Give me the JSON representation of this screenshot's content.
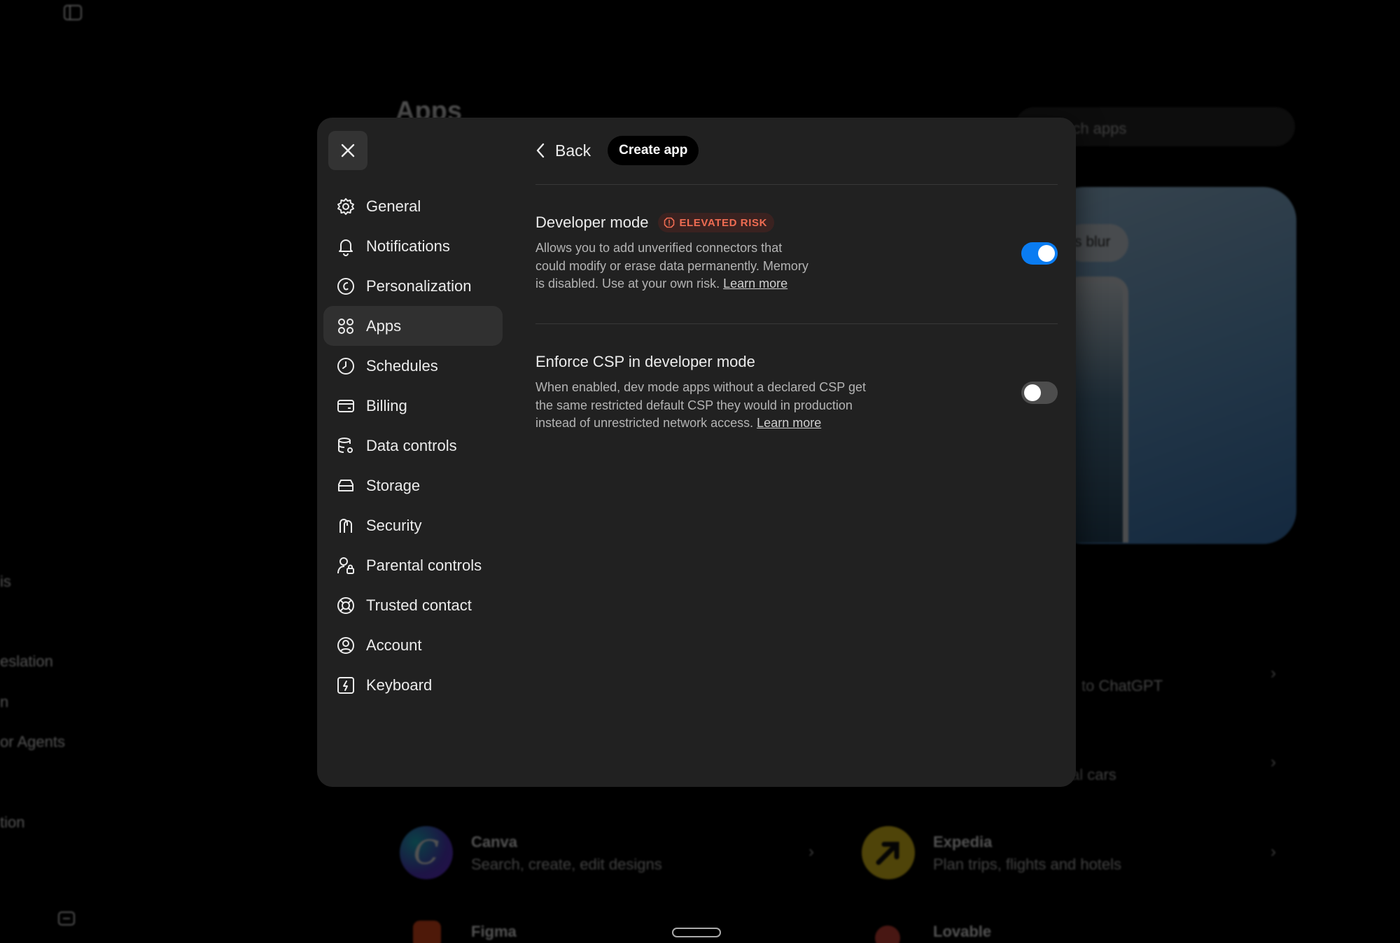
{
  "background": {
    "page_title": "Apps",
    "search_placeholder": "rch apps",
    "hero_chip": "s blur",
    "side_fragments": [
      "is",
      "eslation",
      "n",
      "or Agents",
      "tion"
    ],
    "rows": [
      {
        "title": "",
        "subtitle": "to ChatGPT"
      },
      {
        "title": "",
        "subtitle": "al cars"
      },
      {
        "title": "Canva",
        "subtitle": "Search, create, edit designs"
      },
      {
        "title": "Expedia",
        "subtitle": "Plan trips, flights and hotels"
      },
      {
        "title": "Figma",
        "subtitle": ""
      },
      {
        "title": "Lovable",
        "subtitle": ""
      }
    ],
    "canva_letter": "C"
  },
  "modal": {
    "close_icon": "close-icon",
    "nav": [
      {
        "label": "General",
        "icon": "gear-icon"
      },
      {
        "label": "Notifications",
        "icon": "bell-icon"
      },
      {
        "label": "Personalization",
        "icon": "personalization-icon"
      },
      {
        "label": "Apps",
        "icon": "apps-grid-icon",
        "active": true
      },
      {
        "label": "Schedules",
        "icon": "clock-icon"
      },
      {
        "label": "Billing",
        "icon": "credit-card-icon"
      },
      {
        "label": "Data controls",
        "icon": "database-gear-icon"
      },
      {
        "label": "Storage",
        "icon": "storage-icon"
      },
      {
        "label": "Security",
        "icon": "security-icon"
      },
      {
        "label": "Parental controls",
        "icon": "parental-icon"
      },
      {
        "label": "Trusted contact",
        "icon": "lifebuoy-icon"
      },
      {
        "label": "Account",
        "icon": "user-circle-icon"
      },
      {
        "label": "Keyboard",
        "icon": "keyboard-icon"
      }
    ],
    "topbar": {
      "back_label": "Back",
      "create_label": "Create app"
    },
    "settings": {
      "developer_mode": {
        "title": "Developer mode",
        "badge": "ELEVATED RISK",
        "desc_line1": "Allows you to add unverified connectors that",
        "desc_line2": "could modify or erase data permanently. Memory",
        "desc_line3": "is disabled. Use at your own risk.",
        "learn_more": "Learn more",
        "enabled": true
      },
      "enforce_csp": {
        "title": "Enforce CSP in developer mode",
        "desc_line1": "When enabled, dev mode apps without a declared CSP get",
        "desc_line2": "the same restricted default CSP they would in production",
        "desc_line3": "instead of unrestricted network access.",
        "learn_more": "Learn more",
        "enabled": false
      }
    }
  },
  "colors": {
    "modal_bg": "#212121",
    "active_nav_bg": "#303030",
    "toggle_on": "#0a7cf2",
    "risk": "#ef6c52"
  }
}
